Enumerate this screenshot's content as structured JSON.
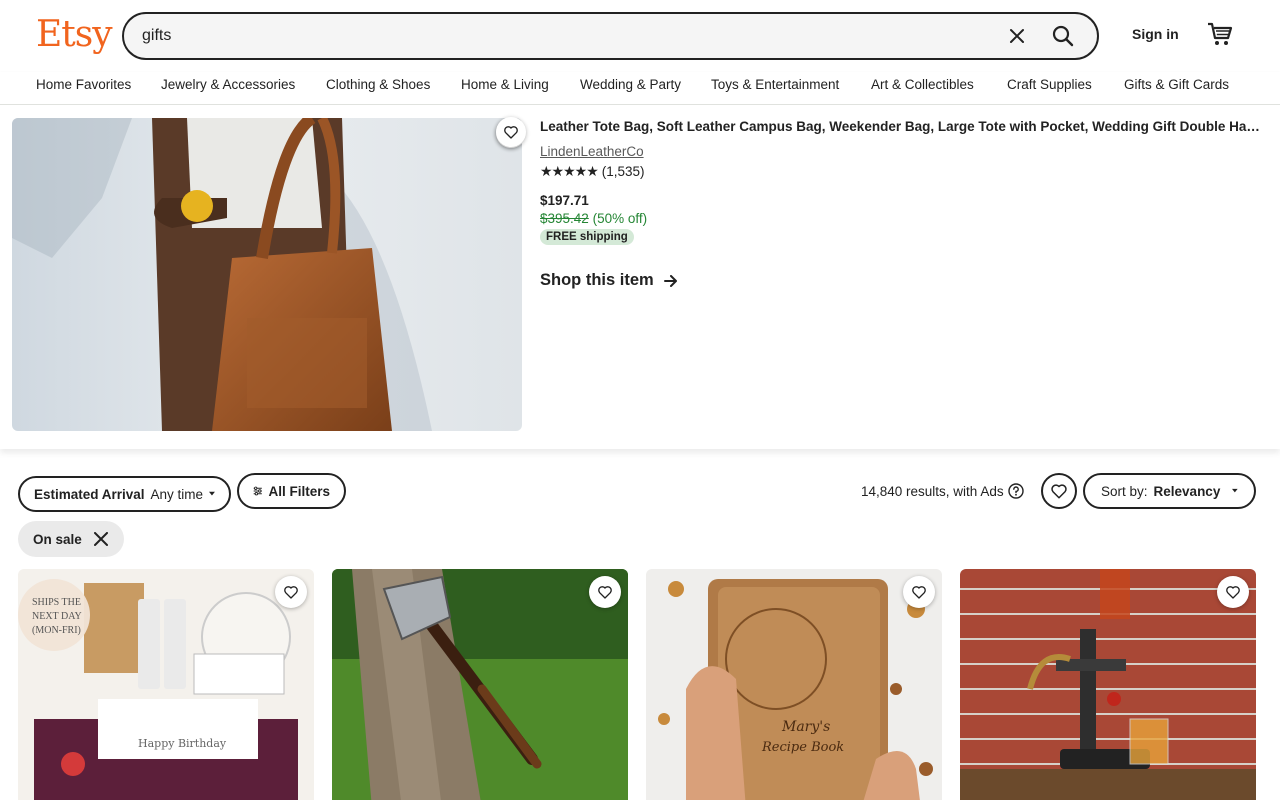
{
  "logo": "Etsy",
  "search": {
    "value": "gifts"
  },
  "header": {
    "signin": "Sign in"
  },
  "nav": [
    "Home Favorites",
    "Jewelry & Accessories",
    "Clothing & Shoes",
    "Home & Living",
    "Wedding & Party",
    "Toys & Entertainment",
    "Art & Collectibles",
    "Craft Supplies",
    "Gifts & Gift Cards"
  ],
  "featured": {
    "title": "Leather Tote Bag, Soft Leather Campus Bag, Weekender Bag, Large Tote with Pocket, Wedding Gift Double Handle",
    "shop": "LindenLeatherCo",
    "stars": "★★★★★",
    "reviews": "(1,535)",
    "price": "$197.71",
    "original_price": "$395.42",
    "discount": "(50% off)",
    "shipping_badge": "FREE shipping",
    "cta": "Shop this item"
  },
  "filters": {
    "arrival_label": "Estimated Arrival",
    "arrival_value": "Any time",
    "all_filters": "All Filters",
    "on_sale": "On sale",
    "results": "14,840 results, with Ads",
    "sort_label": "Sort by:",
    "sort_value": "Relevancy"
  },
  "listings": [
    {
      "badge_line1": "SHIPS THE",
      "badge_line2": "NEXT DAY",
      "badge_line3": "(MON-FRI)"
    },
    {},
    {
      "engraving_line1": "Mary's",
      "engraving_line2": "Recipe Book"
    },
    {}
  ],
  "colors": {
    "brand": "#F1641E",
    "sale_green": "#258635",
    "badge_bg": "#d4e9d7"
  }
}
